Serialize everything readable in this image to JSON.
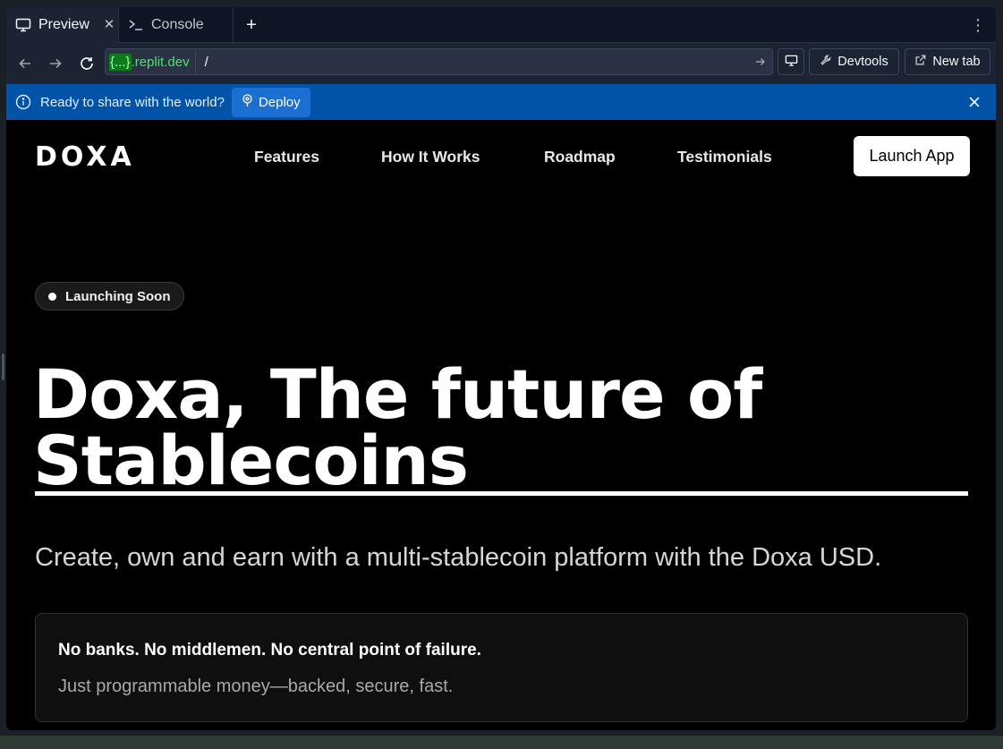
{
  "tabs": [
    {
      "label": "Preview",
      "icon": "monitor-icon"
    },
    {
      "label": "Console",
      "icon": "terminal-icon"
    }
  ],
  "urlbar": {
    "domain_brace": "{...}",
    "domain_suffix": ".replit.dev",
    "path": "/",
    "devtools_label": "Devtools",
    "newtab_label": "New tab"
  },
  "banner": {
    "message": "Ready to share with the world?",
    "deploy_label": "Deploy"
  },
  "site": {
    "logo": "DOXA",
    "nav": [
      "Features",
      "How It Works",
      "Roadmap",
      "Testimonials"
    ],
    "cta": "Launch App",
    "badge": "Launching Soon",
    "hero_line1": "Doxa, The future of",
    "hero_line2": "Stablecoins",
    "subtitle": "Create, own and earn with a multi-stablecoin platform with the Doxa USD.",
    "card_title": "No banks. No middlemen. No central point of failure.",
    "card_text": "Just programmable money—backed, secure, fast."
  },
  "colors": {
    "banner": "#0053a6",
    "deploy_button": "#1a6fd1",
    "domain_green": "#4ce06a",
    "site_bg": "#000000"
  }
}
